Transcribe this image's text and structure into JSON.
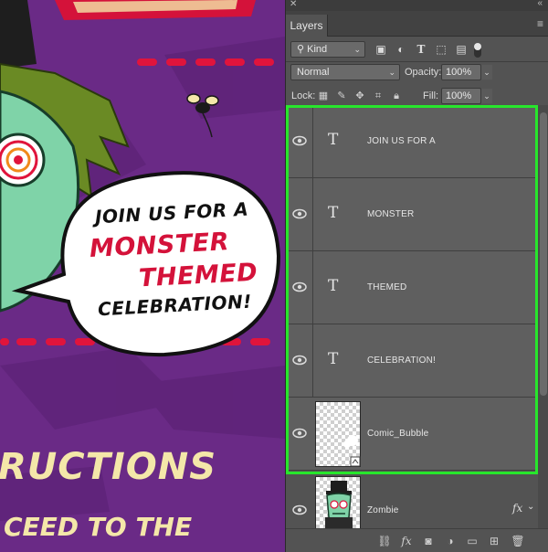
{
  "artwork": {
    "bubble_lines": [
      "JOIN US FOR A",
      "MONSTER",
      "THEMED",
      "CELEBRATION!"
    ],
    "heading_fragment": "RUCTIONS",
    "subtext_fragment": "CEED TO THE",
    "colors": {
      "background": "#6a2a86",
      "accent_red": "#d4123a",
      "cream": "#f4e7a9",
      "zombie_green": "#7fd3a8"
    }
  },
  "panel": {
    "tab_label": "Layers",
    "filter": {
      "kind_label": "Kind",
      "icons": [
        "image-filter-icon",
        "adjustment-filter-icon",
        "type-filter-icon",
        "shape-filter-icon",
        "smart-object-filter-icon"
      ]
    },
    "blend_mode": "Normal",
    "opacity_label": "Opacity:",
    "opacity_value": "100%",
    "lock_label": "Lock:",
    "fill_label": "Fill:",
    "fill_value": "100%",
    "layers": [
      {
        "name": "JOIN US FOR A",
        "kind": "text"
      },
      {
        "name": "MONSTER",
        "kind": "text"
      },
      {
        "name": "THEMED",
        "kind": "text"
      },
      {
        "name": "CELEBRATION!",
        "kind": "text"
      },
      {
        "name": "Comic_Bubble",
        "kind": "smart-object"
      },
      {
        "name": "Zombie",
        "kind": "image",
        "fx": "fx"
      }
    ],
    "highlight_color": "#27e62c"
  }
}
